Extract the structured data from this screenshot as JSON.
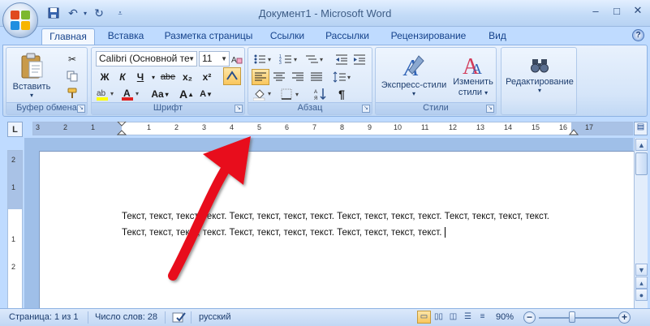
{
  "window": {
    "title": "Документ1 - Microsoft Word",
    "controls": {
      "minimize": "–",
      "maximize": "□",
      "close": "✕"
    }
  },
  "quick_access": {
    "save_icon": "save-icon",
    "undo_icon": "undo-icon",
    "redo_icon": "redo-icon",
    "customize_icon": "customize-icon"
  },
  "tabs": [
    {
      "label": "Главная",
      "active": true
    },
    {
      "label": "Вставка"
    },
    {
      "label": "Разметка страницы"
    },
    {
      "label": "Ссылки"
    },
    {
      "label": "Рассылки"
    },
    {
      "label": "Рецензирование"
    },
    {
      "label": "Вид"
    }
  ],
  "help_label": "?",
  "ribbon": {
    "clipboard": {
      "label": "Буфер обмена",
      "paste_label": "Вставить"
    },
    "font": {
      "label": "Шрифт",
      "font_name": "Calibri (Основной те",
      "font_size": "11",
      "bold": "Ж",
      "italic": "К",
      "underline": "Ч",
      "strike": "abe",
      "subscript": "x₂",
      "superscript": "x²",
      "change_case": "Aa",
      "grow": "A",
      "shrink": "A"
    },
    "paragraph": {
      "label": "Абзац",
      "pilcrow": "¶"
    },
    "styles": {
      "label": "Стили",
      "express_styles": "Экспресс-стили",
      "change_styles_line1": "Изменить",
      "change_styles_line2": "стили"
    },
    "editing": {
      "label": "Редактирование"
    }
  },
  "ruler": {
    "corner": "L",
    "numbers": [
      "3",
      "2",
      "1",
      "1",
      "2",
      "3",
      "4",
      "5",
      "6",
      "7",
      "8",
      "9",
      "10",
      "11",
      "12",
      "13",
      "14",
      "15",
      "16",
      "17"
    ],
    "vertical_numbers": [
      "2",
      "1",
      "1",
      "2"
    ]
  },
  "document": {
    "line1": "Текст, текст, текст, текст. Текст, текст, текст, текст. Текст, текст, текст, текст. Текст, текст, текст, текст.",
    "line2": "Текст, текст, текст, текст. Текст, текст, текст, текст. Текст, текст, текст, текст."
  },
  "status": {
    "page": "Страница: 1 из 1",
    "words": "Число слов: 28",
    "language": "русский",
    "zoom": "90%",
    "zoom_value": 90
  },
  "colors": {
    "accent": "#15428b",
    "ribbon_bg": "#dbe8f9",
    "annotation_arrow": "#e8101a"
  }
}
